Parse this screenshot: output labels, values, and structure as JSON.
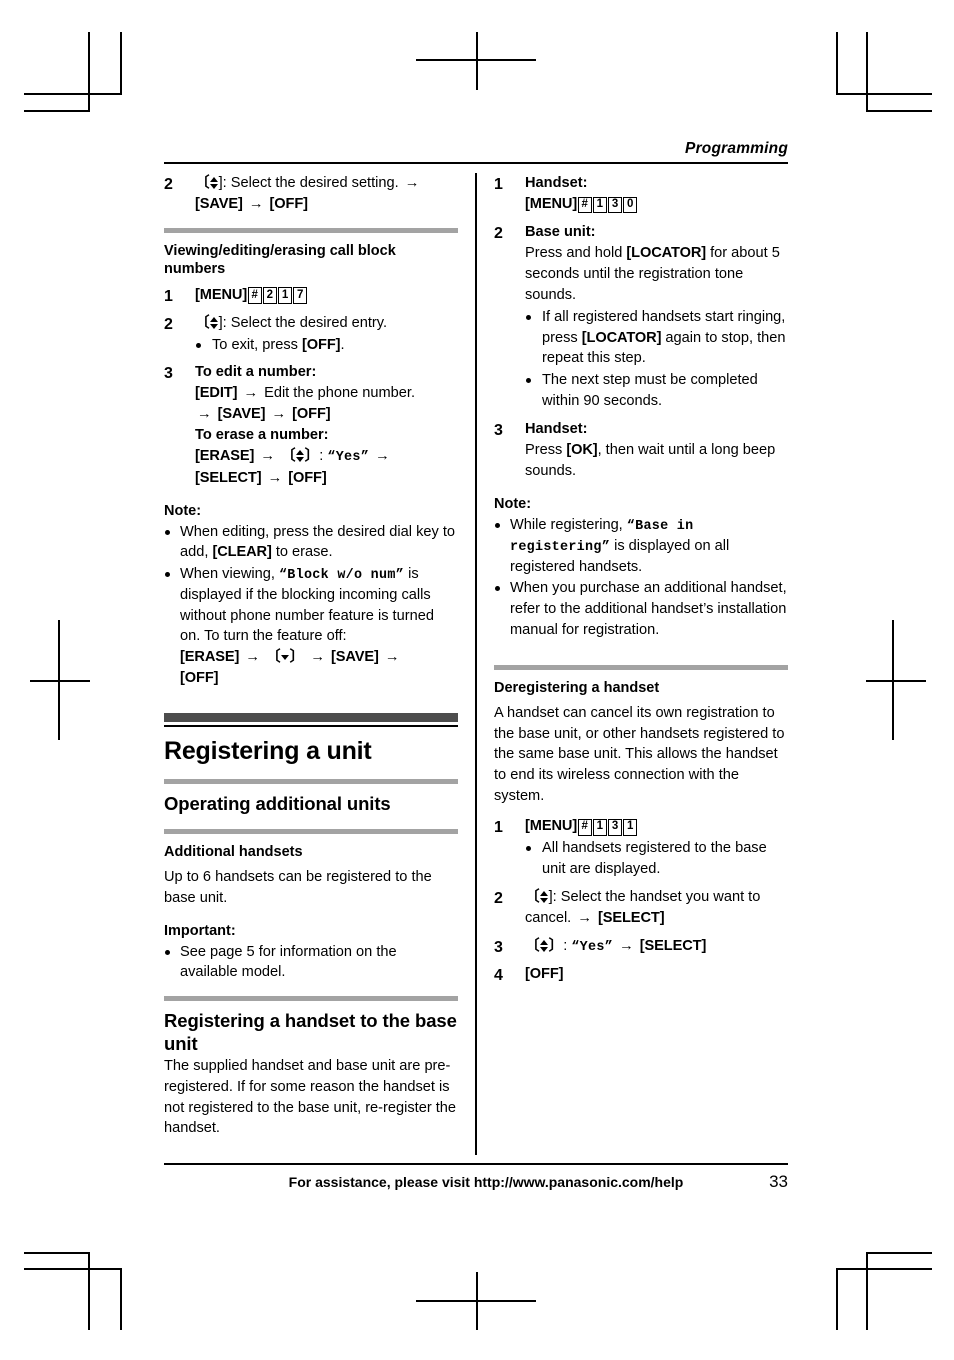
{
  "page": {
    "running_head": "Programming",
    "number": "33",
    "footer_text": "For assistance, please visit http://www.panasonic.com/help"
  },
  "left_column": {
    "continued_step": {
      "num": "2",
      "line1_prefix": "]: Select the desired setting.",
      "line2": "[SAVE]",
      "line2_end": "[OFF]"
    },
    "subhead_viewing": "Viewing/editing/erasing call block numbers",
    "steps": [
      {
        "num": "1",
        "label_menu": "[MENU]",
        "keys": [
          "#",
          "2",
          "1",
          "7"
        ]
      },
      {
        "num": "2",
        "text": "]: Select the desired entry.",
        "bullet": "To exit, press ",
        "bullet_key": "[OFF]",
        "bullet_end": "."
      },
      {
        "num": "3",
        "edit_title": "To edit a number:",
        "edit_key1": "[EDIT]",
        "edit_text": "Edit the phone number.",
        "edit_key2": "[SAVE]",
        "edit_key3": "[OFF]",
        "erase_title": "To erase a number:",
        "erase_key1": "[ERASE]",
        "erase_value": "“Yes”",
        "erase_key2": "[SELECT]",
        "erase_key3": "[OFF]"
      }
    ],
    "note_title": "Note:",
    "notes": [
      {
        "part1": "When editing, press the desired dial key to add, ",
        "key": "[CLEAR]",
        "part2": " to erase."
      },
      {
        "part1": "When viewing, ",
        "lcd": "“Block w/o num”",
        "part2": " is displayed if the blocking incoming calls without phone number feature is turned on. To turn the feature off:",
        "key1": "[ERASE]",
        "key3": "[SAVE]",
        "key4": "[OFF]"
      }
    ],
    "chapter_title": "Registering a unit",
    "section_title": "Operating additional units",
    "subhead_additional": "Additional handsets",
    "additional_body": "Up to 6 handsets can be registered to the base unit.",
    "important_title": "Important:",
    "important_bullet": "See page 5 for information on the available model.",
    "section_title2": "Registering a handset to the base unit",
    "section2_body": "The supplied handset and base unit are pre-registered. If for some reason the handset is not registered to the base unit, re-register the handset."
  },
  "right_column": {
    "steps": [
      {
        "num": "1",
        "title": "Handset:",
        "label_menu": "[MENU]",
        "keys": [
          "#",
          "1",
          "3",
          "0"
        ]
      },
      {
        "num": "2",
        "title": "Base unit:",
        "text_a": "Press and hold ",
        "key": "[LOCATOR]",
        "text_b": " for about 5 seconds until the registration tone sounds.",
        "bullets": [
          {
            "part1": "If all registered handsets start ringing, press ",
            "key": "[LOCATOR]",
            "part2": " again to stop, then repeat this step."
          },
          {
            "part1": "The next step must be completed within 90 seconds."
          }
        ]
      },
      {
        "num": "3",
        "title": "Handset:",
        "text_a": "Press ",
        "key": "[OK]",
        "text_b": ", then wait until a long beep sounds."
      }
    ],
    "note_title": "Note:",
    "notes": [
      {
        "part1": "While registering, ",
        "lcd": "“Base in registering”",
        "part2": " is displayed on all registered handsets."
      },
      {
        "part1": "When you purchase an additional handset, refer to the additional handset’s installation manual for registration."
      }
    ],
    "subhead_dereg": "Deregistering a handset",
    "dereg_body": "A handset can cancel its own registration to the base unit, or other handsets registered to the same base unit. This allows the handset to end its wireless connection with the system.",
    "dereg_steps": [
      {
        "num": "1",
        "label_menu": "[MENU]",
        "keys": [
          "#",
          "1",
          "3",
          "1"
        ],
        "bullet": "All handsets registered to the base unit are displayed."
      },
      {
        "num": "2",
        "text": "]: Select the handset you want to cancel.",
        "key": "[SELECT]"
      },
      {
        "num": "3",
        "value": "“Yes”",
        "key": "[SELECT]"
      },
      {
        "num": "4",
        "key": "[OFF]"
      }
    ]
  },
  "symbols": {
    "arrow": "→",
    "bracket_open": "〔",
    "bracket_close": "〕"
  }
}
